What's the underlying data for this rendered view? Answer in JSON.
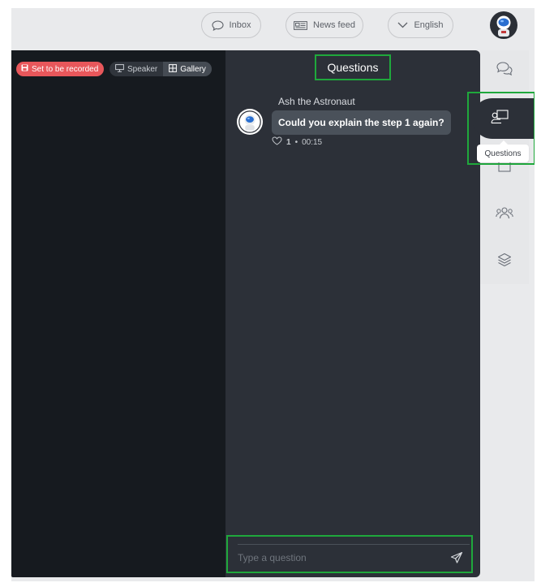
{
  "topbar": {
    "inbox_label": "Inbox",
    "newsfeed_label": "News feed",
    "language_label": "English"
  },
  "video": {
    "record_badge": "Set to be recorded",
    "view_speaker": "Speaker",
    "view_gallery": "Gallery",
    "active_view": "Gallery"
  },
  "panel": {
    "title": "Questions",
    "messages": [
      {
        "author": "Ash the Astronaut",
        "text": "Could you explain the step 1 again?",
        "likes": "1",
        "time": "00:15"
      }
    ],
    "composer_placeholder": "Type a question"
  },
  "rail": {
    "items": [
      "chat-icon",
      "questions-icon",
      "calendar-icon",
      "people-icon",
      "layers-icon"
    ],
    "active": "questions-icon",
    "tooltip": "Questions"
  },
  "colors": {
    "background": "#e9eaec",
    "video_bg": "#161a1f",
    "panel_bg": "#2c3038",
    "bubble_bg": "#4a515a",
    "record_red": "#e8575b",
    "highlight_green": "#1fa83c"
  }
}
